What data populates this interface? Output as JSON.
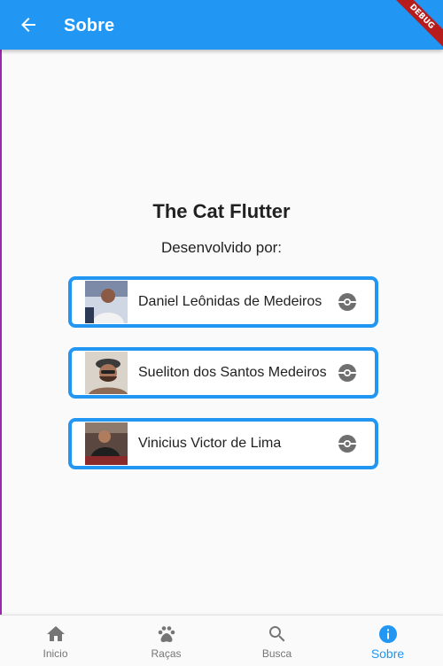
{
  "appbar": {
    "title": "Sobre",
    "back_icon": "arrow-back-icon",
    "debug_banner": "DEBUG"
  },
  "about": {
    "title": "The Cat Flutter",
    "subtitle": "Desenvolvido por:"
  },
  "developers": [
    {
      "name": "Daniel Leônidas de Medeiros",
      "icon": "github-icon"
    },
    {
      "name": "Sueliton dos Santos Medeiros",
      "icon": "github-icon"
    },
    {
      "name": "Vinicius Victor de Lima",
      "icon": "github-icon"
    }
  ],
  "bottom_nav": {
    "items": [
      {
        "label": "Inicio",
        "icon": "home-icon"
      },
      {
        "label": "Raças",
        "icon": "paw-icon"
      },
      {
        "label": "Busca",
        "icon": "search-icon"
      },
      {
        "label": "Sobre",
        "icon": "info-icon",
        "active": true
      }
    ]
  },
  "colors": {
    "primary": "#2196f3",
    "inactive": "#757575",
    "text": "#212121",
    "background": "#fafafa"
  }
}
